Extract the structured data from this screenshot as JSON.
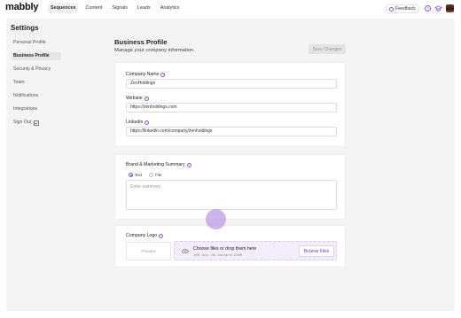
{
  "app": {
    "logo": "mabbly"
  },
  "nav": {
    "items": [
      {
        "label": "Sequences",
        "active": true
      },
      {
        "label": "Content",
        "active": false
      },
      {
        "label": "Signals",
        "active": false
      },
      {
        "label": "Leads",
        "active": false
      },
      {
        "label": "Analytics",
        "active": false
      }
    ],
    "feedback_label": "Feedback",
    "help_glyph": "?"
  },
  "settings": {
    "title": "Settings",
    "sidebar": [
      {
        "label": "Personal Profile",
        "active": false
      },
      {
        "label": "Business Profile",
        "active": true
      },
      {
        "label": "Security & Privacy",
        "active": false
      },
      {
        "label": "Team",
        "active": false
      },
      {
        "label": "Notifications",
        "active": false
      },
      {
        "label": "Integrations",
        "active": false
      },
      {
        "label": "Sign Out",
        "active": false
      }
    ]
  },
  "profile": {
    "title": "Business Profile",
    "subtitle": "Manage your company information.",
    "save_label": "Save Changes",
    "company_name": {
      "label": "Company Name",
      "value": "ZenHoldings"
    },
    "website": {
      "label": "Website",
      "value": "https://zenholdings.com"
    },
    "linkedin": {
      "label": "Linkedin",
      "value": "https://linkedin.com/company/zenholdings"
    },
    "summary": {
      "label": "Brand & Marketing Summary",
      "options": [
        "Text",
        "File"
      ],
      "selected": "Text",
      "placeholder": "Enter summary"
    },
    "logo": {
      "label": "Company Logo",
      "preview_label": "Preview",
      "drop_title": "Choose files or drop them here",
      "drop_hint": ".pdf, .doc, .xls, .csv up to 10mb",
      "browse_label": "Browse Files"
    }
  },
  "colors": {
    "accent": "#8a52d6",
    "panel_bg": "#f4f4f4",
    "dropzone_bg": "#f2ecfb"
  },
  "icons": [
    "feedback-icon",
    "help-icon",
    "learn-icon",
    "avatar",
    "sign-out-icon",
    "info-icon",
    "cloud-upload-icon"
  ]
}
